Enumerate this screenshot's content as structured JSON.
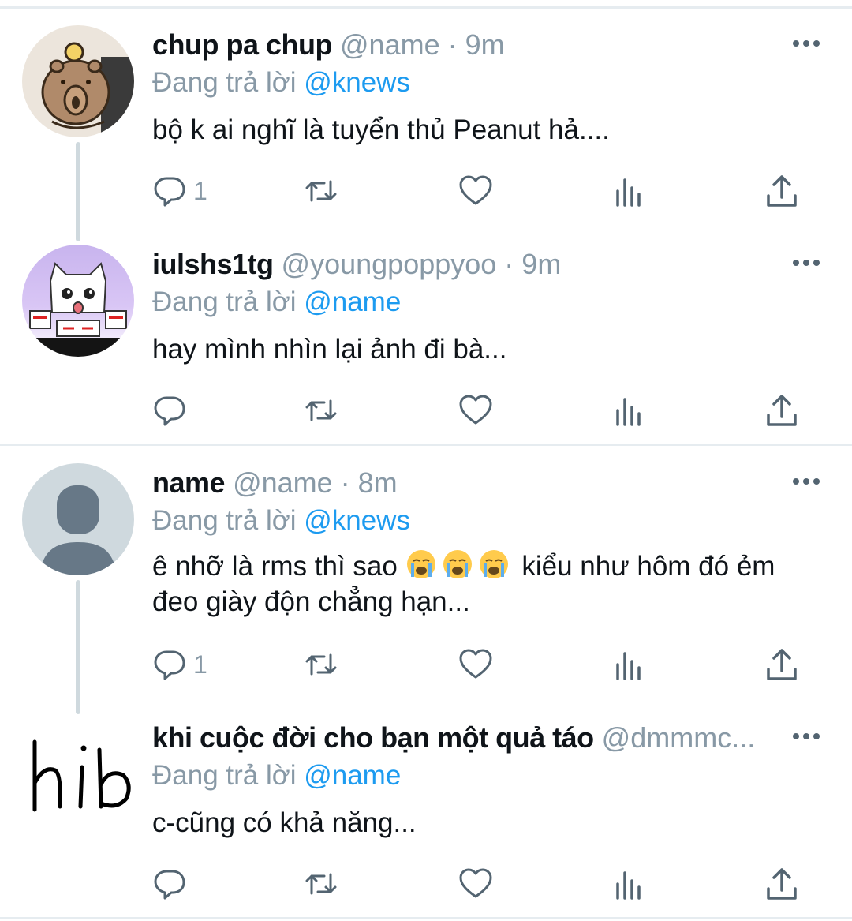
{
  "tweets": [
    {
      "display_name": "chup pa chup",
      "handle": "@name · 9m",
      "replying_prefix": "Đang trả lời",
      "replying_to": "@knews",
      "text": "bộ k ai nghĩ là tuyển thủ Peanut hả....",
      "reply_count": "1"
    },
    {
      "display_name": "iulshs1tg",
      "handle": "@youngpoppyoo · 9m",
      "replying_prefix": "Đang trả lời",
      "replying_to": "@name",
      "text": "hay mình nhìn lại ảnh đi bà...",
      "reply_count": ""
    },
    {
      "display_name": "name",
      "handle": "@name · 8m",
      "replying_prefix": "Đang trả lời",
      "replying_to": "@knews",
      "text_before": "ê nhỡ là rms thì sao",
      "text_after": "kiểu như hôm đó ẻm đeo giày độn chẳng hạn...",
      "reply_count": "1"
    },
    {
      "display_name": "khi cuộc đời cho bạn một quả táo",
      "handle": "@dmmmc...",
      "replying_prefix": "Đang trả lời",
      "replying_to": "@name",
      "text": "c-cũng có khả năng...",
      "reply_count": "",
      "avatar_text": "hib"
    }
  ],
  "icons": {
    "reply": "reply-icon",
    "retweet": "retweet-icon",
    "like": "heart-icon",
    "views": "views-icon",
    "share": "share-icon",
    "more": "more-icon"
  },
  "colors": {
    "link": "#1d9bf0",
    "meta": "#8899a6",
    "icon": "#536471",
    "divider": "#e6ecf0"
  }
}
